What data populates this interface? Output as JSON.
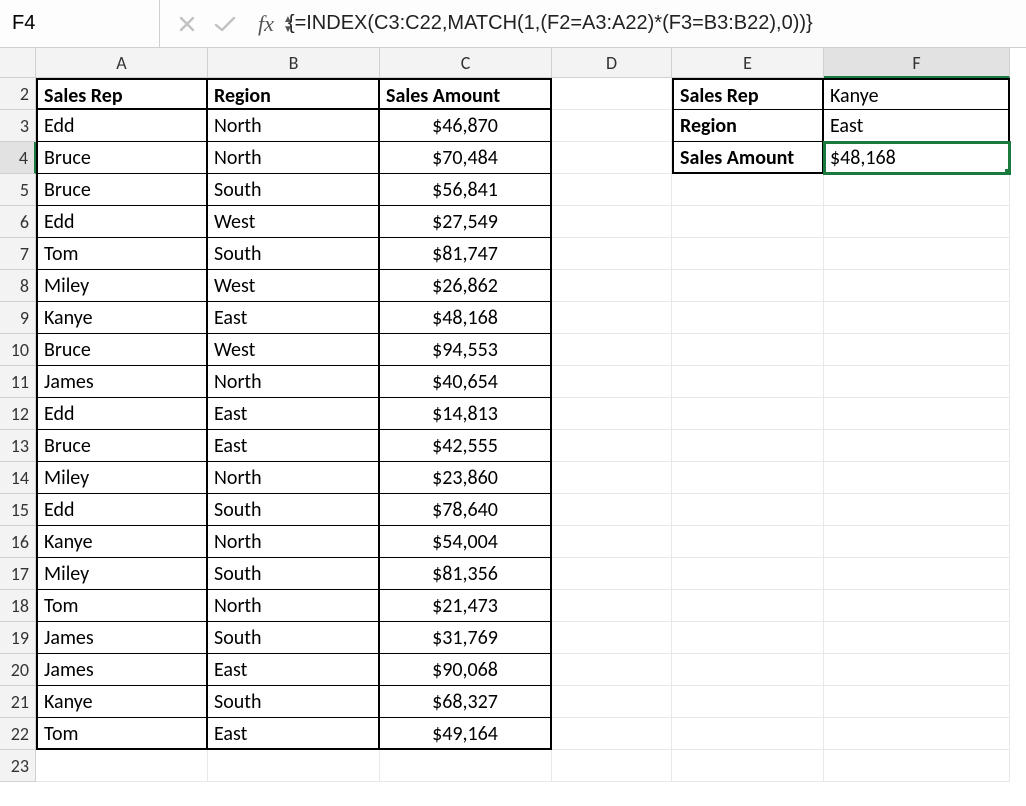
{
  "formula_bar": {
    "cell_ref": "F4",
    "fx_label": "fx",
    "formula": "{=INDEX(C3:C22,MATCH(1,(F2=A3:A22)*(F3=B3:B22),0))}"
  },
  "columns": [
    "A",
    "B",
    "C",
    "D",
    "E",
    "F"
  ],
  "active_col": "F",
  "active_row": 4,
  "rows_visible": [
    2,
    3,
    4,
    5,
    6,
    7,
    8,
    9,
    10,
    11,
    12,
    13,
    14,
    15,
    16,
    17,
    18,
    19,
    20,
    21,
    22,
    23
  ],
  "main_table": {
    "headers": {
      "rep": "Sales Rep",
      "region": "Region",
      "amount": "Sales Amount"
    },
    "rows": [
      {
        "rep": "Edd",
        "region": "North",
        "amount": "$46,870"
      },
      {
        "rep": "Bruce",
        "region": "North",
        "amount": "$70,484"
      },
      {
        "rep": "Bruce",
        "region": "South",
        "amount": "$56,841"
      },
      {
        "rep": "Edd",
        "region": "West",
        "amount": "$27,549"
      },
      {
        "rep": "Tom",
        "region": "South",
        "amount": "$81,747"
      },
      {
        "rep": "Miley",
        "region": "West",
        "amount": "$26,862"
      },
      {
        "rep": "Kanye",
        "region": "East",
        "amount": "$48,168"
      },
      {
        "rep": "Bruce",
        "region": "West",
        "amount": "$94,553"
      },
      {
        "rep": "James",
        "region": "North",
        "amount": "$40,654"
      },
      {
        "rep": "Edd",
        "region": "East",
        "amount": "$14,813"
      },
      {
        "rep": "Bruce",
        "region": "East",
        "amount": "$42,555"
      },
      {
        "rep": "Miley",
        "region": "North",
        "amount": "$23,860"
      },
      {
        "rep": "Edd",
        "region": "South",
        "amount": "$78,640"
      },
      {
        "rep": "Kanye",
        "region": "North",
        "amount": "$54,004"
      },
      {
        "rep": "Miley",
        "region": "South",
        "amount": "$81,356"
      },
      {
        "rep": "Tom",
        "region": "North",
        "amount": "$21,473"
      },
      {
        "rep": "James",
        "region": "South",
        "amount": "$31,769"
      },
      {
        "rep": "James",
        "region": "East",
        "amount": "$90,068"
      },
      {
        "rep": "Kanye",
        "region": "South",
        "amount": "$68,327"
      },
      {
        "rep": "Tom",
        "region": "East",
        "amount": "$49,164"
      }
    ]
  },
  "lookup_table": {
    "rows": [
      {
        "label": "Sales Rep",
        "value": "Kanye"
      },
      {
        "label": "Region",
        "value": "East"
      },
      {
        "label": "Sales Amount",
        "value": "$48,168"
      }
    ]
  }
}
